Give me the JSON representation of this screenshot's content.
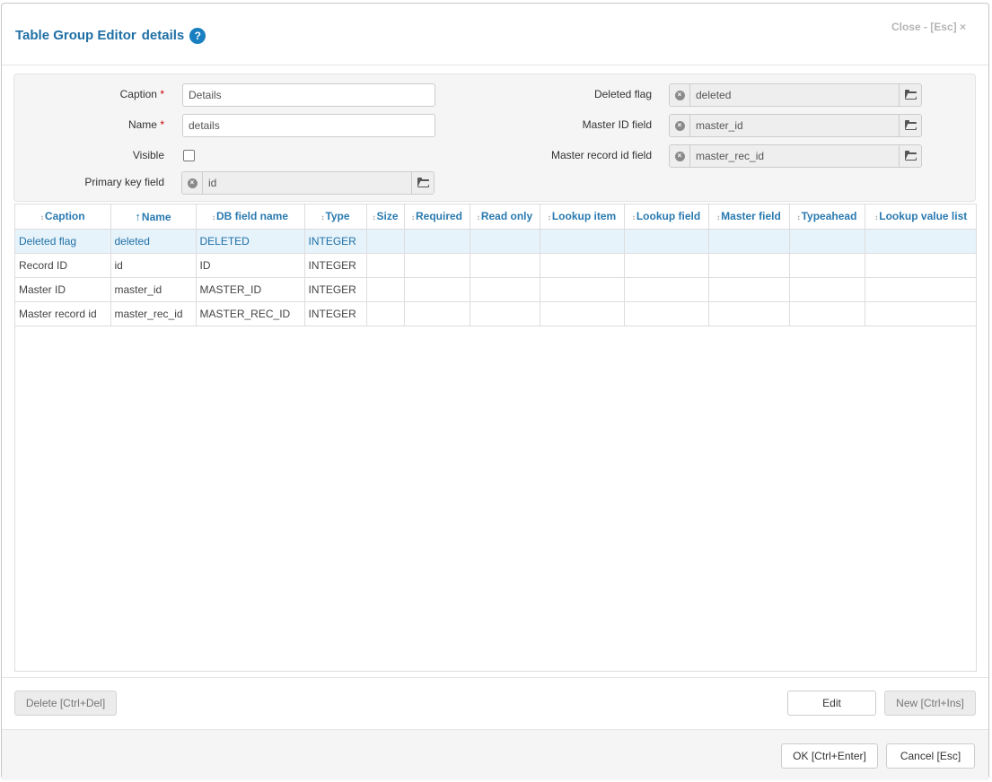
{
  "dialog": {
    "title_main": "Table Group Editor",
    "title_sub": "details",
    "help_glyph": "?",
    "close_label": "Close - [Esc] ×"
  },
  "form": {
    "caption_label": "Caption",
    "caption_value": "Details",
    "name_label": "Name",
    "name_value": "details",
    "visible_label": "Visible",
    "visible_checked": false,
    "pk_label": "Primary key field",
    "pk_value": "id",
    "deleted_flag_label": "Deleted flag",
    "deleted_flag_value": "deleted",
    "master_id_label": "Master ID field",
    "master_id_value": "master_id",
    "master_rec_label": "Master record id field",
    "master_rec_value": "master_rec_id",
    "required_mark": "*"
  },
  "grid": {
    "sort_glyph": "↕",
    "active_sort_glyph": "↑",
    "columns": [
      "Caption",
      "Name",
      "DB field name",
      "Type",
      "Size",
      "Required",
      "Read only",
      "Lookup item",
      "Lookup field",
      "Master field",
      "Typeahead",
      "Lookup value list"
    ],
    "rows": [
      [
        "Deleted flag",
        "deleted",
        "DELETED",
        "INTEGER",
        "",
        "",
        "",
        "",
        "",
        "",
        "",
        ""
      ],
      [
        "Record ID",
        "id",
        "ID",
        "INTEGER",
        "",
        "",
        "",
        "",
        "",
        "",
        "",
        ""
      ],
      [
        "Master ID",
        "master_id",
        "MASTER_ID",
        "INTEGER",
        "",
        "",
        "",
        "",
        "",
        "",
        "",
        ""
      ],
      [
        "Master record id",
        "master_rec_id",
        "MASTER_REC_ID",
        "INTEGER",
        "",
        "",
        "",
        "",
        "",
        "",
        "",
        ""
      ]
    ]
  },
  "toolbar": {
    "delete_label": "Delete [Ctrl+Del]",
    "edit_label": "Edit",
    "new_label": "New [Ctrl+Ins]"
  },
  "footer": {
    "ok_label": "OK [Ctrl+Enter]",
    "cancel_label": "Cancel [Esc]"
  },
  "colors": {
    "accent": "#1f6fa5",
    "header_text": "#2a7ab0",
    "selected_row": "#e6f3fb"
  }
}
